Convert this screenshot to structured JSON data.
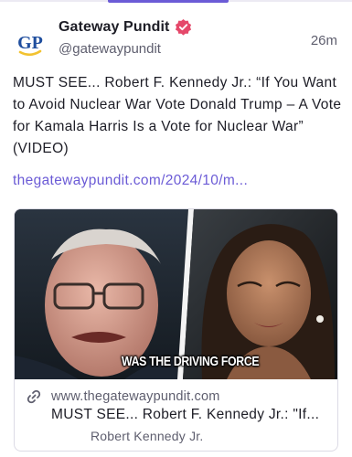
{
  "author": {
    "display_name": "Gateway Pundit",
    "handle": "@gatewaypundit",
    "avatar_initials": "GP",
    "verified": true
  },
  "post": {
    "timestamp": "26m",
    "text": "MUST SEE... Robert F. Kennedy Jr.: “If You Want to Avoid Nuclear War Vote Donald Trump – A Vote for Kamala Harris Is a Vote for Nuclear War” (VIDEO)",
    "link": "thegatewaypundit.com/2024/10/m..."
  },
  "link_card": {
    "image_caption": "WAS THE DRIVING FORCE",
    "domain": "www.thegatewaypundit.com",
    "title": "MUST SEE... Robert F. Kennedy Jr.: \"If...",
    "description": "Robert Kennedy Jr."
  },
  "colors": {
    "accent": "#6b5bd6",
    "avatar_blue": "#1f4e9e",
    "avatar_yellow": "#f2c230",
    "verified": "#e5486a",
    "text": "#1d1d26",
    "muted": "#5e5e6e"
  },
  "icons": {
    "verified": "verified-badge-icon",
    "link": "link-icon"
  }
}
